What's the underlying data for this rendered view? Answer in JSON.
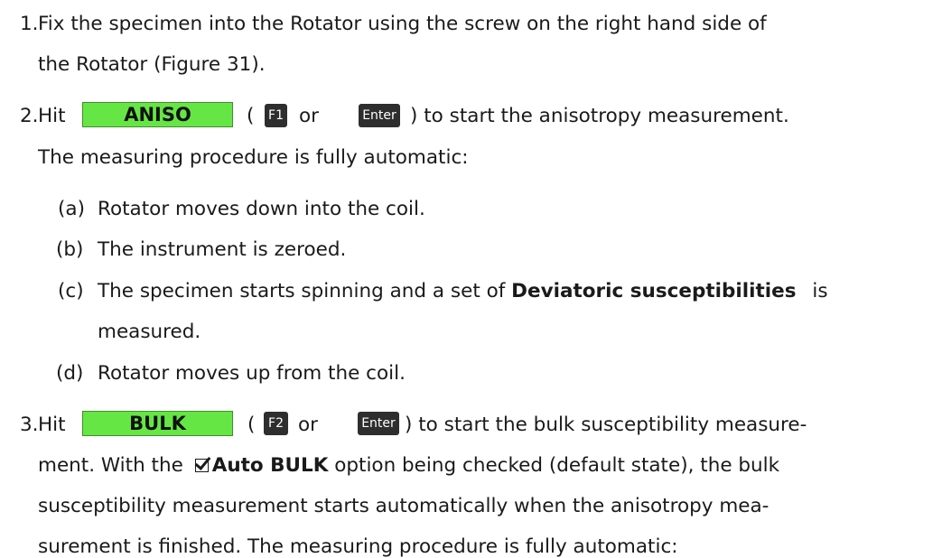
{
  "steps": [
    {
      "number": "1.",
      "line1": "Fix the specimen into the Rotator using the screw on the right hand side of",
      "line2": "the Rotator (Figure 31)."
    },
    {
      "number": "2.",
      "hit": "Hit",
      "button": "ANISO",
      "paren_open": "(",
      "key1": "F1",
      "or": "or",
      "key2": "Enter",
      "after_keys": ") to start the anisotropy measurement.",
      "line2": "The measuring procedure is fully automatic:",
      "substeps": [
        {
          "label": "(a)",
          "text": "Rotator moves down into the coil."
        },
        {
          "label": "(b)",
          "text": "The instrument is zeroed."
        },
        {
          "label": "(c)",
          "text_before": "The specimen starts spinning and a set of",
          "bold": "Deviatoric susceptibilities",
          "text_after": "is",
          "line2": "measured."
        },
        {
          "label": "(d)",
          "text": "Rotator moves up from the coil."
        }
      ]
    },
    {
      "number": "3.",
      "hit": "Hit",
      "button": "BULK",
      "paren_open": "(",
      "key1": "F2",
      "or": "or",
      "key2": "Enter",
      "after_keys": ") to start the bulk susceptibility measure-",
      "line2_before": "ment. With the",
      "option_label": "Auto BULK",
      "line2_after": "option being checked (default state), the bulk",
      "line3": "susceptibility measurement starts automatically when the anisotropy mea-",
      "line4": "surement is finished. The measuring procedure is fully automatic:"
    }
  ]
}
